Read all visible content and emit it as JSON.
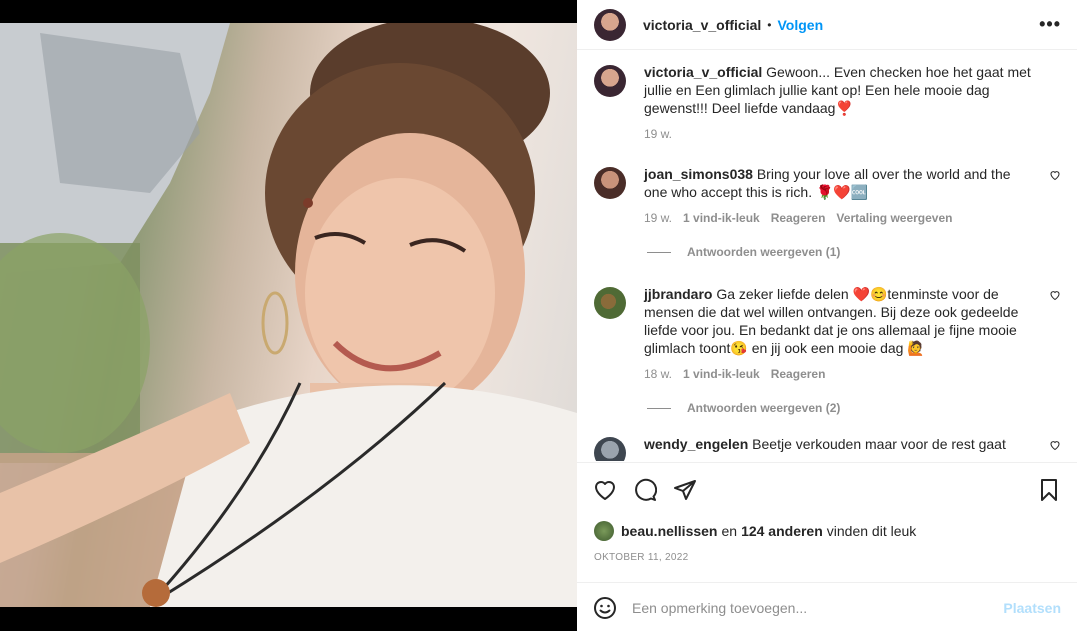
{
  "post": {
    "username": "victoria_v_official",
    "dot": "•",
    "follow_label": "Volgen",
    "more_label": "•••"
  },
  "caption": {
    "username": "victoria_v_official",
    "text": "Gewoon... Even checken hoe het gaat met jullie en Een glimlach jullie kant op! Een hele mooie dag gewenst!!! Deel liefde vandaag❣️",
    "time": "19 w."
  },
  "comments": [
    {
      "username": "joan_simons038",
      "text": "Bring your love all over the world and the one who accept this is rich. 🌹❤️🆒",
      "time": "19 w.",
      "likes": "1 vind-ik-leuk",
      "reply": "Reageren",
      "translate": "Vertaling weergeven",
      "replies": "Antwoorden weergeven (1)"
    },
    {
      "username": "jjbrandaro",
      "text": "Ga zeker liefde delen ❤️😊tenminste voor de mensen die dat wel willen ontvangen. Bij deze ook gedeelde liefde voor jou. En bedankt dat je ons allemaal je fijne mooie glimlach toont😘 en jij ook een mooie dag 🙋",
      "time": "18 w.",
      "likes": "1 vind-ik-leuk",
      "reply": "Reageren",
      "replies": "Antwoorden weergeven (2)"
    },
    {
      "username": "wendy_engelen",
      "text": "Beetje verkouden maar voor de rest gaat"
    }
  ],
  "likes": {
    "user": "beau.nellissen",
    "and": "en",
    "others": "124 anderen",
    "suffix": "vinden dit leuk"
  },
  "date": "OKTOBER 11, 2022",
  "add_comment": {
    "placeholder": "Een opmerking toevoegen...",
    "post_label": "Plaatsen"
  },
  "colors": {
    "accent": "#0095f6",
    "post_disabled": "#b2dffc",
    "secondary_text": "#8e8e8e"
  }
}
